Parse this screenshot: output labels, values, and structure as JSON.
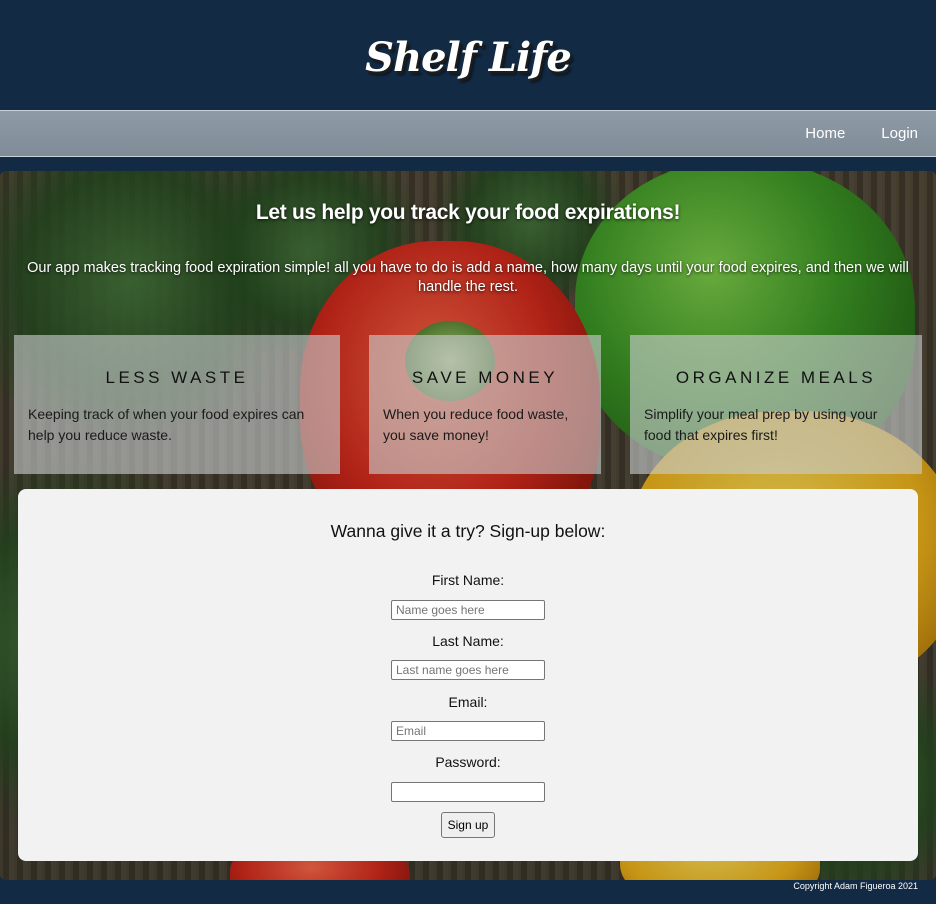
{
  "header": {
    "logo_text": "Shelf Life"
  },
  "nav": {
    "items": [
      {
        "label": "Home"
      },
      {
        "label": "Login"
      }
    ]
  },
  "hero": {
    "title": "Let us help you track your food expirations!",
    "description": "Our app makes tracking food expiration simple! all you have to do is add a name, how many days until your food expires, and then we will handle the rest."
  },
  "features": [
    {
      "title": "LESS WASTE",
      "text": "Keeping track of when your food expires can help you reduce waste."
    },
    {
      "title": "SAVE MONEY",
      "text": "When you reduce food waste, you save money!"
    },
    {
      "title": "ORGANIZE MEALS",
      "text": "Simplify your meal prep by using your food that expires first!"
    }
  ],
  "signup": {
    "heading": "Wanna give it a try? Sign-up below:",
    "fields": [
      {
        "label": "First Name:",
        "placeholder": "Name goes here",
        "value": ""
      },
      {
        "label": "Last Name:",
        "placeholder": "Last name goes here",
        "value": ""
      },
      {
        "label": "Email:",
        "placeholder": "Email",
        "value": ""
      },
      {
        "label": "Password:",
        "placeholder": "",
        "value": ""
      }
    ],
    "button_label": "Sign up"
  },
  "footer": {
    "copyright": "Copyright Adam Figueroa 2021"
  },
  "colors": {
    "header_bg": "#122a44",
    "nav_bg": "#8e9aa5",
    "panel_bg": "#f2f2f2"
  }
}
